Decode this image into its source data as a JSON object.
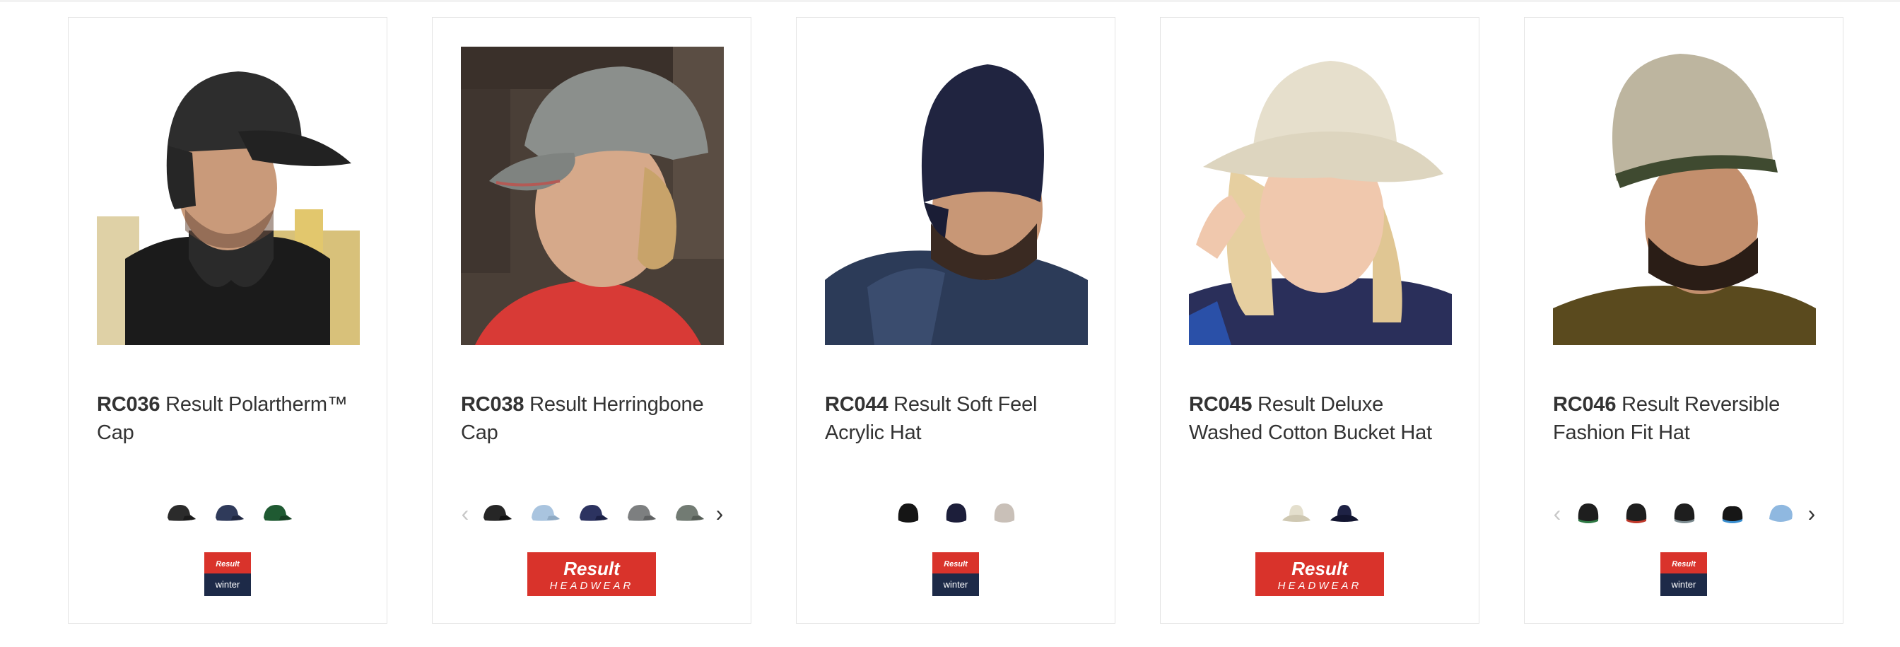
{
  "products": [
    {
      "code": "RC036",
      "name": "Result Polartherm™ Cap",
      "photo_alt": "RC036 Result Polartherm™ Cap",
      "swatches": [
        {
          "color": "#2b2b2b",
          "brim": "#1a1a1a"
        },
        {
          "color": "#2f3a5a",
          "brim": "#1f2740"
        },
        {
          "color": "#1f5a32",
          "brim": "#153f22"
        }
      ],
      "has_arrows": false,
      "brand_logo": "result-winter-essentials",
      "brand_text": {
        "top": "Result",
        "bottom": "winter"
      }
    },
    {
      "code": "RC038",
      "name": "Result Herringbone Cap",
      "photo_alt": "RC038 Result Herringbone Cap",
      "swatches": [
        {
          "color": "#262626",
          "brim": "#111111"
        },
        {
          "color": "#a9c4df",
          "brim": "#8faac4"
        },
        {
          "color": "#2c3360",
          "brim": "#1b2045"
        },
        {
          "color": "#7d7f80",
          "brim": "#5f6162"
        },
        {
          "color": "#727b73",
          "brim": "#555d56"
        }
      ],
      "has_arrows": true,
      "brand_logo": "result-headwear",
      "brand_text": {
        "top": "Result",
        "bottom": "HEADWEAR"
      }
    },
    {
      "code": "RC044",
      "name": "Result Soft Feel Acrylic Hat",
      "photo_alt": "RC044 Result Soft Feel Acrylic Hat",
      "swatches": [
        {
          "color": "#151515",
          "brim": "#0a0a0a"
        },
        {
          "color": "#1c1e3a",
          "brim": "#101225"
        },
        {
          "color": "#c9c0b8",
          "brim": "#aaa097"
        }
      ],
      "has_arrows": false,
      "brand_logo": "result-winter-essentials",
      "brand_text": {
        "top": "Result",
        "bottom": "winter"
      }
    },
    {
      "code": "RC045",
      "name": "Result Deluxe Washed Cotton Bucket Hat",
      "photo_alt": "RC045 Result Deluxe Washed Cotton Bucket Hat",
      "swatches": [
        {
          "color": "#e4dfcd",
          "brim": "#cfc8b2"
        },
        {
          "color": "#1e2245",
          "brim": "#121530"
        }
      ],
      "has_arrows": false,
      "brand_logo": "result-headwear",
      "brand_text": {
        "top": "Result",
        "bottom": "HEADWEAR"
      }
    },
    {
      "code": "RC046",
      "name": "Result Reversible Fashion Fit Hat",
      "photo_alt": "RC046 Result Reversible Fashion Fit Hat",
      "swatches": [
        {
          "color": "#1e1e1e",
          "brim": "#2f7a45"
        },
        {
          "color": "#1e1e1e",
          "brim": "#c0392b"
        },
        {
          "color": "#1e1e1e",
          "brim": "#7b8a8f"
        },
        {
          "color": "#161616",
          "brim": "#3a8fd0"
        },
        {
          "color": "#8fb8e0",
          "brim": "#6f9ac2"
        }
      ],
      "has_arrows": true,
      "brand_logo": "result-winter-essentials",
      "brand_text": {
        "top": "Result",
        "bottom": "winter"
      }
    }
  ],
  "colors": {
    "card_border": "#e3e3e3",
    "text": "#333333",
    "logo_red": "#d9332b",
    "logo_navy": "#1d2a48"
  },
  "icons": {
    "prev": "‹",
    "next": "›"
  }
}
